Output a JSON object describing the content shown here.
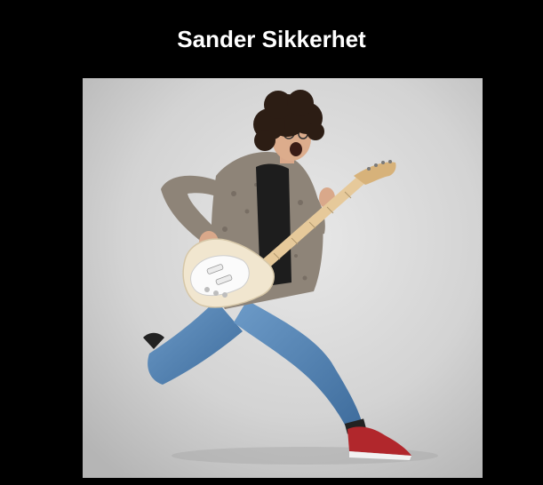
{
  "page": {
    "title": "Sander Sikkerhet",
    "background_color": "#000000",
    "title_color": "#ffffff"
  },
  "photo": {
    "subject": "guitarist-photo"
  }
}
